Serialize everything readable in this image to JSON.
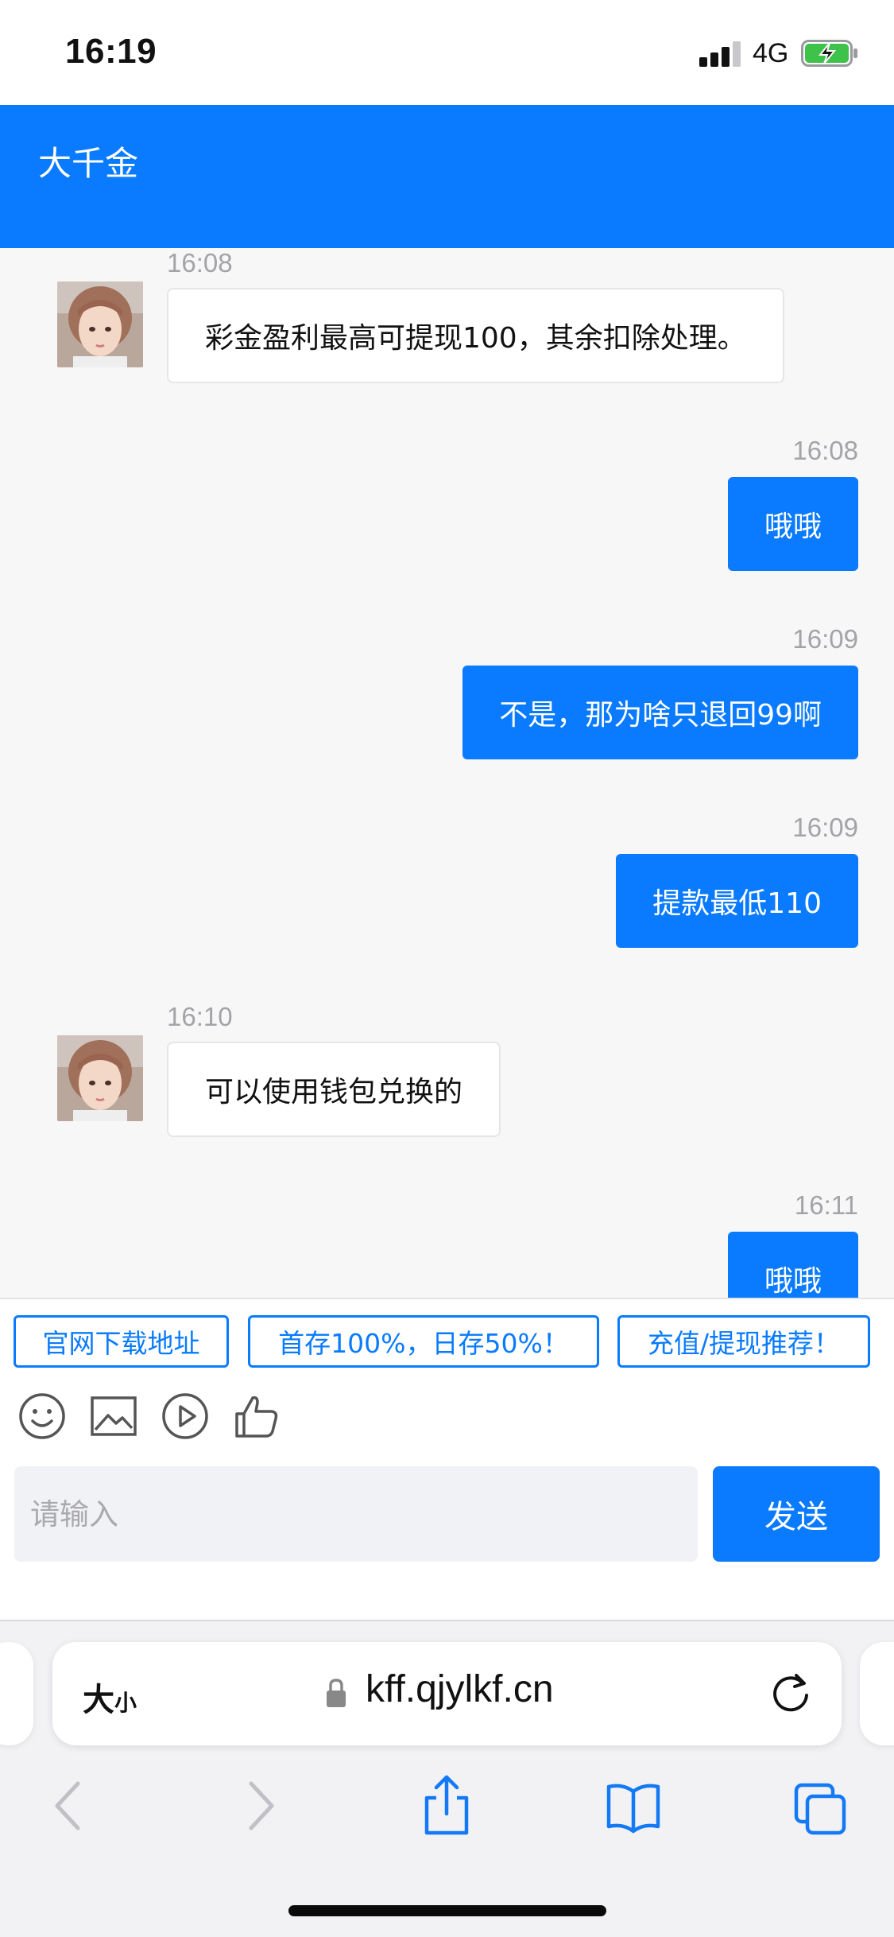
{
  "status_bar": {
    "time": "16:19",
    "network": "4G"
  },
  "header": {
    "title": "大千金"
  },
  "messages": [
    {
      "time": "16:08",
      "text": "彩金盈利最高可提现100，其余扣除处理。",
      "side": "in"
    },
    {
      "time": "16:08",
      "text": "哦哦",
      "side": "out"
    },
    {
      "time": "16:09",
      "text": "不是，那为啥只退回99啊",
      "side": "out"
    },
    {
      "time": "16:09",
      "text": "提款最低110",
      "side": "out"
    },
    {
      "time": "16:10",
      "text": "可以使用钱包兑换的",
      "side": "in"
    },
    {
      "time": "16:11",
      "text": "哦哦",
      "side": "out"
    }
  ],
  "quick_replies": [
    "官网下载地址",
    "首存100%，日存50%！",
    "充值/提现推荐！"
  ],
  "toolbar_icons": [
    "emoji-icon",
    "image-icon",
    "video-icon",
    "thumbs-up-icon"
  ],
  "composer": {
    "placeholder": "请输入",
    "send_label": "发送"
  },
  "browser": {
    "text_size_big": "大",
    "text_size_small": "小",
    "url": "kff.qjylkf.cn"
  },
  "colors": {
    "accent": "#0a7bff",
    "background": "#f7f7f8",
    "timestamp": "#a3a3a8"
  }
}
